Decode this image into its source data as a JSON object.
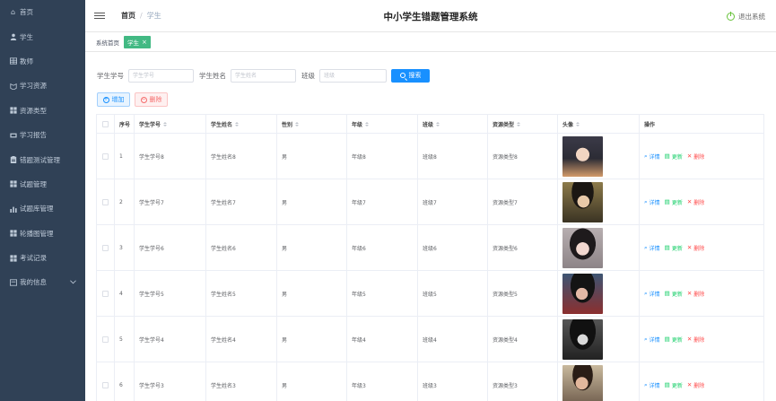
{
  "sidebar": {
    "items": [
      {
        "label": "首页",
        "icon": "home-icon"
      },
      {
        "label": "学生",
        "icon": "user-icon"
      },
      {
        "label": "教师",
        "icon": "grid-icon"
      },
      {
        "label": "学习资源",
        "icon": "resource-icon"
      },
      {
        "label": "资源类型",
        "icon": "apps-icon"
      },
      {
        "label": "学习报告",
        "icon": "report-icon"
      },
      {
        "label": "错题测试管理",
        "icon": "test-icon"
      },
      {
        "label": "试题管理",
        "icon": "apps-icon"
      },
      {
        "label": "试题库管理",
        "icon": "bar-chart-icon"
      },
      {
        "label": "轮播图管理",
        "icon": "apps-icon"
      },
      {
        "label": "考试记录",
        "icon": "apps-icon"
      },
      {
        "label": "我的信息",
        "icon": "profile-icon"
      }
    ]
  },
  "header": {
    "breadcrumb_home": "首页",
    "breadcrumb_current": "学生",
    "system_title": "中小学生错题管理系统",
    "logout_label": "退出系统"
  },
  "tags": {
    "home": "系统首页",
    "active": "学生"
  },
  "search": {
    "sid_label": "学生学号",
    "sid_placeholder": "学生学号",
    "sname_label": "学生姓名",
    "sname_placeholder": "学生姓名",
    "class_label": "班级",
    "class_placeholder": "班级",
    "button_label": "搜索"
  },
  "actions": {
    "add_label": "增加",
    "delete_label": "删除"
  },
  "table": {
    "headers": {
      "index": "序号",
      "sid": "学生学号",
      "sname": "学生姓名",
      "gender": "性别",
      "grade": "年级",
      "class": "班级",
      "rtype": "资源类型",
      "avatar": "头像",
      "ops": "操作"
    },
    "ops": {
      "detail": "详情",
      "update": "更新",
      "delete": "删除"
    },
    "rows": [
      {
        "index": "1",
        "sid": "学生学号8",
        "sname": "学生姓名8",
        "gender": "男",
        "grade": "年级8",
        "class": "班级8",
        "rtype": "资源类型8"
      },
      {
        "index": "2",
        "sid": "学生学号7",
        "sname": "学生姓名7",
        "gender": "男",
        "grade": "年级7",
        "class": "班级7",
        "rtype": "资源类型7"
      },
      {
        "index": "3",
        "sid": "学生学号6",
        "sname": "学生姓名6",
        "gender": "男",
        "grade": "年级6",
        "class": "班级6",
        "rtype": "资源类型6"
      },
      {
        "index": "4",
        "sid": "学生学号5",
        "sname": "学生姓名5",
        "gender": "男",
        "grade": "年级5",
        "class": "班级5",
        "rtype": "资源类型5"
      },
      {
        "index": "5",
        "sid": "学生学号4",
        "sname": "学生姓名4",
        "gender": "男",
        "grade": "年级4",
        "class": "班级4",
        "rtype": "资源类型4"
      },
      {
        "index": "6",
        "sid": "学生学号3",
        "sname": "学生姓名3",
        "gender": "男",
        "grade": "年级3",
        "class": "班级3",
        "rtype": "资源类型3"
      }
    ]
  },
  "colors": {
    "sidebar_bg": "#304156",
    "primary": "#1890ff",
    "tag_active": "#42b983",
    "danger": "#f56c6c",
    "success": "#13ce66"
  }
}
